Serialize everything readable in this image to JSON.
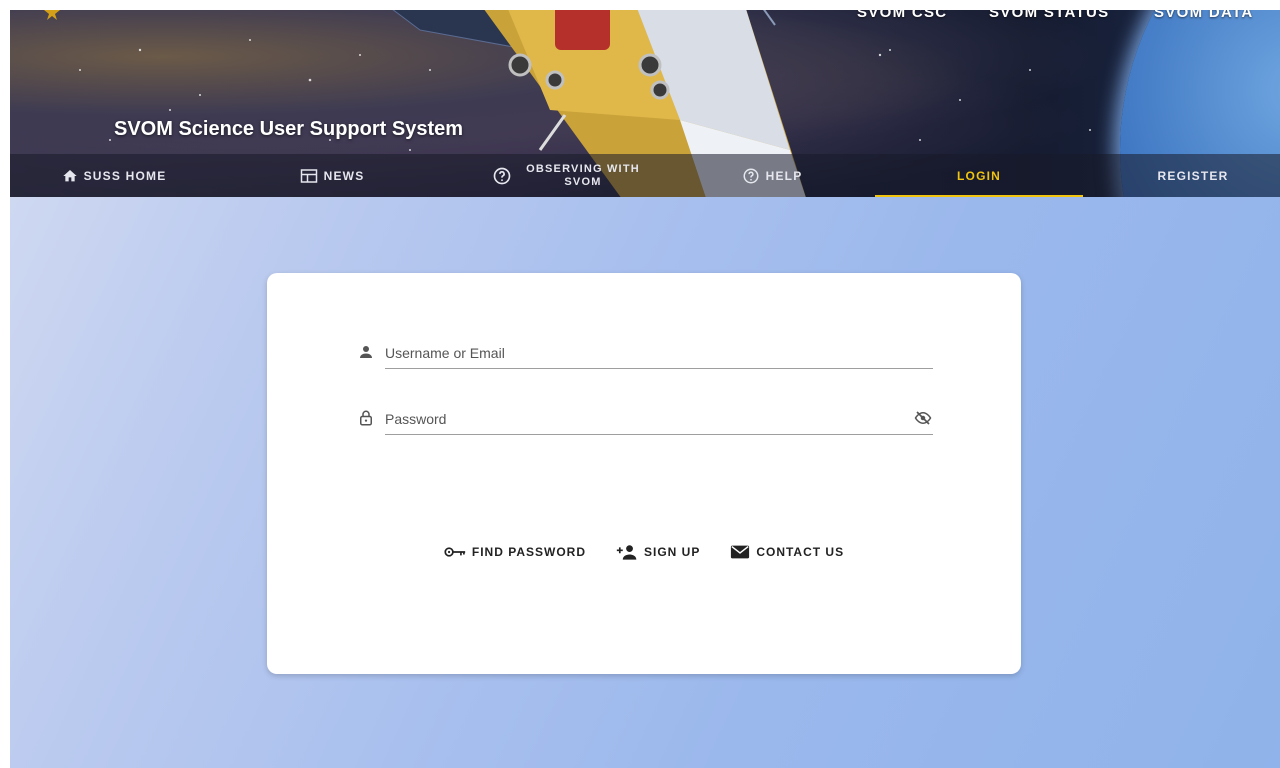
{
  "header": {
    "site_title": "SVOM Science User Support System",
    "top_links": [
      "SVOM CSC",
      "SVOM STATUS",
      "SVOM DATA"
    ]
  },
  "nav": {
    "items": [
      {
        "label": "SUSS HOME",
        "icon": "home-icon"
      },
      {
        "label": "NEWS",
        "icon": "news-icon"
      },
      {
        "label_line1": "OBSERVING WITH",
        "label_line2": "SVOM",
        "icon": "help-circle-icon"
      },
      {
        "label": "HELP",
        "icon": "help-circle-icon"
      },
      {
        "label": "LOGIN",
        "active": true
      },
      {
        "label": "REGISTER"
      }
    ]
  },
  "login": {
    "username_placeholder": "Username or Email",
    "password_placeholder": "Password",
    "actions": [
      {
        "label": "FIND PASSWORD",
        "icon": "key-icon"
      },
      {
        "label": "SIGN UP",
        "icon": "person-add-icon"
      },
      {
        "label": "CONTACT US",
        "icon": "mail-icon"
      }
    ]
  },
  "colors": {
    "active_tab": "#f1c40f",
    "background_start": "#d4dcf2",
    "background_end": "#8fb3ea"
  }
}
